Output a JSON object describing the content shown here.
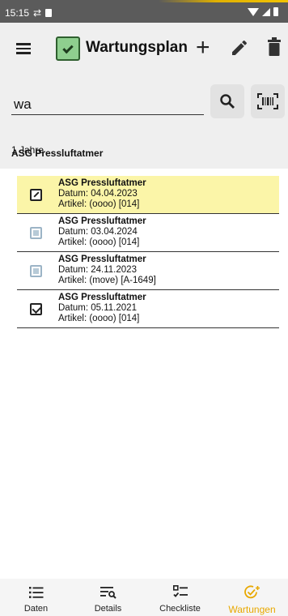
{
  "status_bar": {
    "time": "15:15"
  },
  "app_bar": {
    "title": "Wartungsplan",
    "add_label": "+"
  },
  "search": {
    "value": "wa"
  },
  "filter": {
    "title": "ASG Pressluftatmer",
    "subtitle": "1 Jahre"
  },
  "list": [
    {
      "title": "ASG Pressluftatmer",
      "date": "Datum: 04.04.2023",
      "article": "Artikel:  (oooo) [014]",
      "state": "edit",
      "selected": true
    },
    {
      "title": "ASG Pressluftatmer",
      "date": "Datum: 03.04.2024",
      "article": "Artikel:  (oooo) [014]",
      "state": "disabled",
      "selected": false
    },
    {
      "title": "ASG Pressluftatmer",
      "date": "Datum: 24.11.2023",
      "article": "Artikel:  (move) [A-1649]",
      "state": "disabled",
      "selected": false
    },
    {
      "title": "ASG Pressluftatmer",
      "date": "Datum: 05.11.2021",
      "article": "Artikel:  (oooo) [014]",
      "state": "checked",
      "selected": false
    }
  ],
  "bottom_nav": [
    {
      "label": "Daten",
      "icon": "list-icon",
      "active": false
    },
    {
      "label": "Details",
      "icon": "details-search-icon",
      "active": false
    },
    {
      "label": "Checkliste",
      "icon": "checklist-icon",
      "active": false
    },
    {
      "label": "Wartungen",
      "icon": "maintenance-check-icon",
      "active": true
    }
  ],
  "colors": {
    "selected_row": "#fbf5a8",
    "accent": "#e8a800",
    "app_bar": "#efefef"
  }
}
